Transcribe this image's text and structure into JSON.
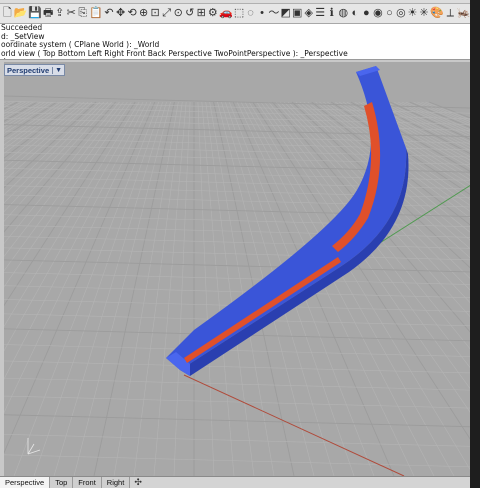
{
  "colors": {
    "viewport_bg": "#a8a8a8",
    "grid_minor": "#b4b4b4",
    "grid_major": "#9c9c9c",
    "x_axis": "#b04a3a",
    "y_axis": "#4f9a4f",
    "tube_blue": "#3a55d8",
    "tube_blue_dark": "#2a3fb0",
    "tube_red": "#e0502a"
  },
  "toolbar": {
    "icons": [
      "new-file-icon",
      "open-file-icon",
      "save-icon",
      "print-icon",
      "import-icon",
      "cut-icon",
      "copy-icon",
      "paste-icon",
      "undo-icon",
      "pan-icon",
      "rotate-view-icon",
      "zoom-icon",
      "zoom-window-icon",
      "zoom-extents-icon",
      "zoom-selected-icon",
      "undo-view-icon",
      "four-viewports-icon",
      "options-icon",
      "car-icon",
      "select-icon",
      "select-none-icon",
      "point-icon",
      "curve-icon",
      "surface-icon",
      "solid-icon",
      "mesh-icon",
      "layer-icon",
      "properties-icon",
      "render-icon",
      "material-icon",
      "rendered-ball-icon",
      "shaded-ball-icon",
      "ghosted-ball-icon",
      "xray-ball-icon",
      "light-icon",
      "snap-icon",
      "palette-icon",
      "ortho-icon",
      "grasshopper-icon"
    ],
    "glyphs": [
      "🗋",
      "📂",
      "💾",
      "🖶",
      "⇪",
      "✂",
      "⎘",
      "📋",
      "↶",
      "✥",
      "⟲",
      "⊕",
      "⊡",
      "⤢",
      "⊙",
      "↺",
      "⊞",
      "⚙",
      "🚗",
      "⬚",
      "◌",
      "•",
      "〜",
      "◩",
      "▣",
      "◈",
      "☰",
      "ℹ",
      "◍",
      "◐",
      "●",
      "◉",
      "○",
      "◎",
      "☀",
      "✳",
      "🎨",
      "⟂",
      "🦗"
    ]
  },
  "command_history": [
    "Succeeded",
    "d: _SetView",
    "oordinate system ( CPlane  World ): _World",
    "orld view ( Top  Bottom  Left  Right  Front  Back  Perspective  TwoPointPerspective ): _Perspective"
  ],
  "command_prompt": "d:",
  "viewport": {
    "title": "Perspective",
    "menu_arrow": "▼"
  },
  "tabs": {
    "items": [
      "Perspective",
      "Top",
      "Front",
      "Right"
    ],
    "active": 0,
    "add_label": "✣"
  }
}
